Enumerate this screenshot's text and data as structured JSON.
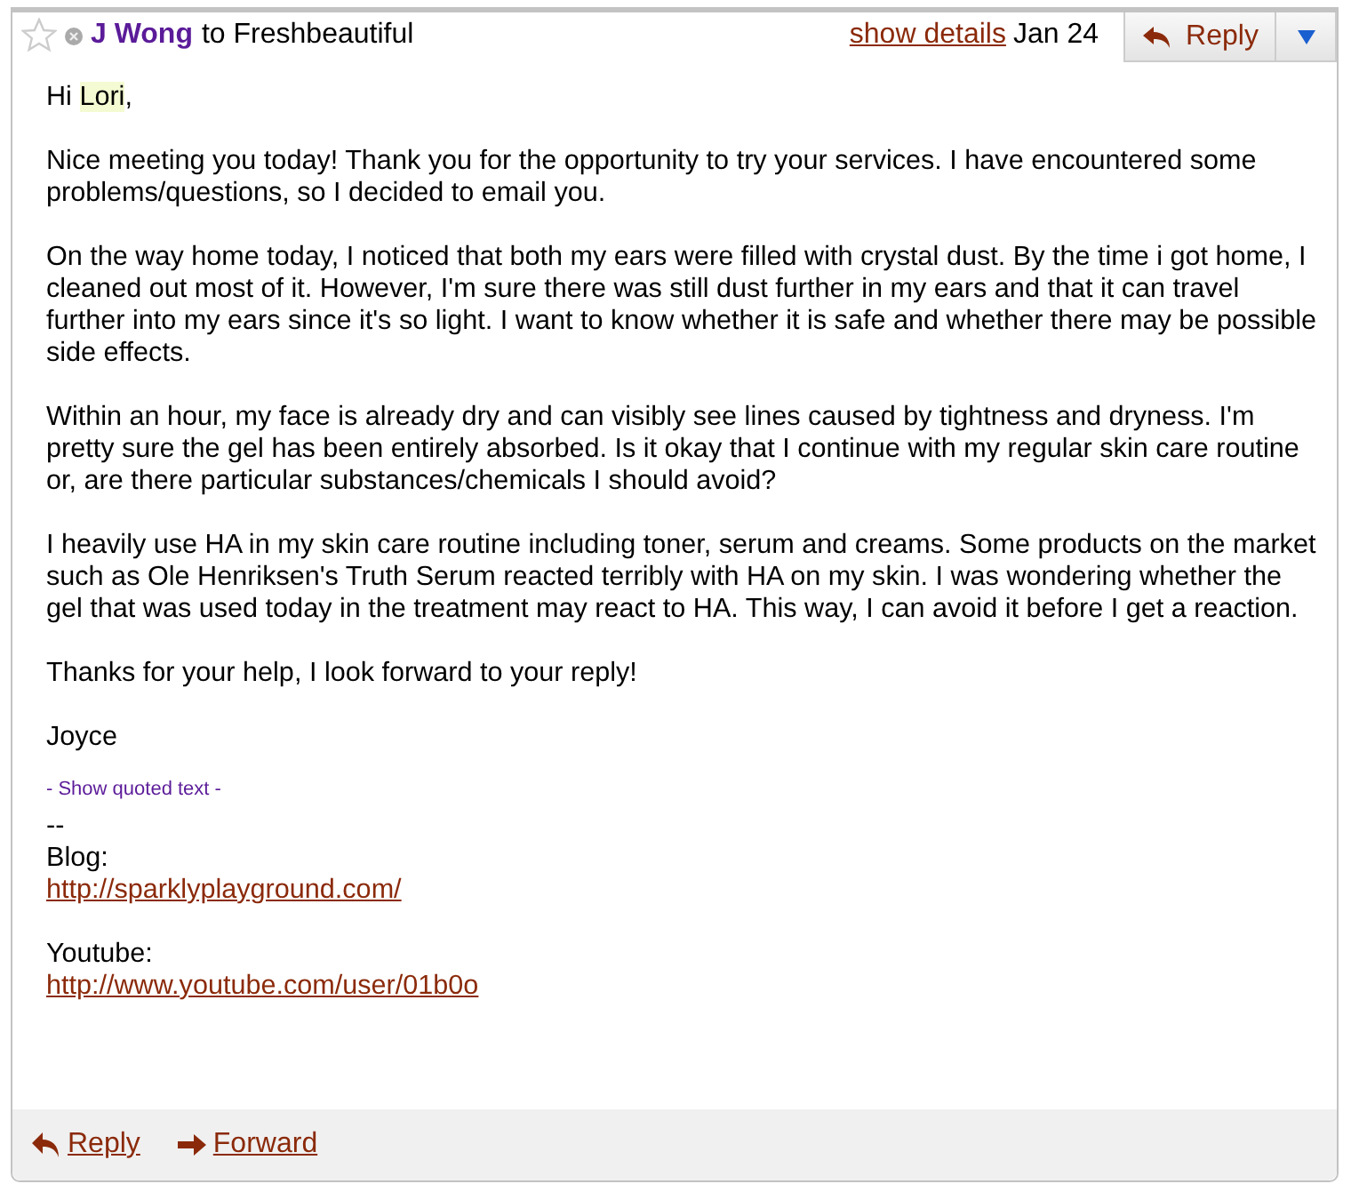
{
  "header": {
    "starred": false,
    "sender": "J Wong",
    "recipient_text": "to Freshbeautiful",
    "show_details": "show details",
    "date": "Jan 24",
    "reply_button": "Reply"
  },
  "greeting": {
    "prefix": "Hi ",
    "name": "Lori",
    "suffix": ","
  },
  "paragraphs": [
    "Nice meeting you today! Thank you for the opportunity to try your services. I have encountered some problems/questions, so I decided to email you.",
    "On the way home today, I noticed that both my ears were filled with crystal dust. By the time i got home, I cleaned out most of it. However, I'm sure there was still dust further in my ears and that it can travel further into my ears since it's so light. I want to know whether it is safe and whether there may be possible side effects.",
    "Within an hour, my face is already dry and can visibly see lines caused by tightness and dryness. I'm pretty sure the gel has been entirely absorbed. Is it okay that I continue with my regular skin care routine or, are there particular substances/chemicals I should avoid?",
    "I heavily use HA in my skin care routine including toner, serum and creams. Some products on the market such as Ole Henriksen's Truth Serum reacted terribly with HA on my skin. I was wondering whether the gel that was used today in the treatment may react to HA. This way, I can avoid it before I get a reaction.",
    "Thanks for your help, I look forward to your reply!",
    "Joyce"
  ],
  "show_quoted": "- Show quoted text -",
  "signature": {
    "separator": "--",
    "blog_label": "Blog:",
    "blog_url": "http://sparklyplayground.com/",
    "youtube_label": "Youtube:",
    "youtube_url": "http://www.youtube.com/user/01b0o"
  },
  "footer": {
    "reply": "Reply",
    "forward": "Forward"
  }
}
